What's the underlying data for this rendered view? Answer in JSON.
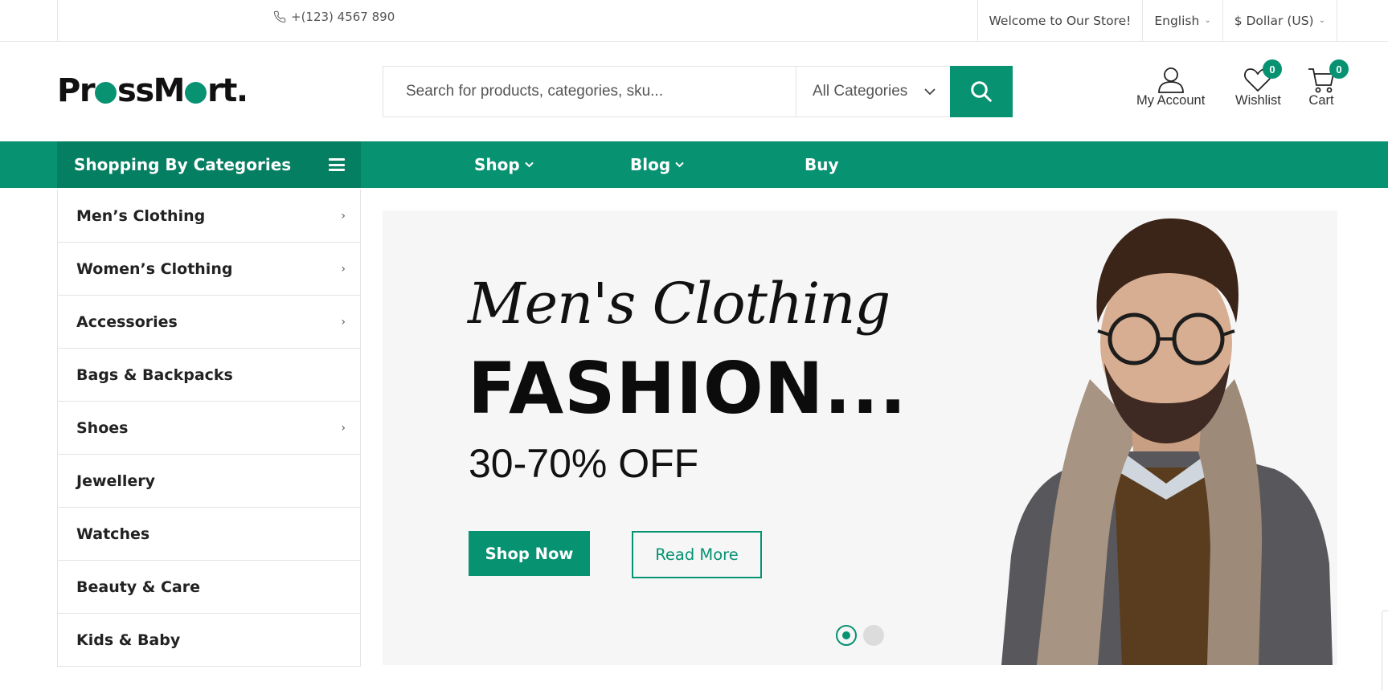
{
  "topbar": {
    "phone": "+(123) 4567 890",
    "welcome": "Welcome to Our Store!",
    "language": "English",
    "currency": "$ Dollar (US)"
  },
  "header": {
    "logo": {
      "part1": "Pr",
      "part2": "ssM",
      "part3": "rt."
    },
    "search": {
      "placeholder": "Search for products, categories, sku...",
      "category": "All Categories"
    },
    "account_label": "My Account",
    "wishlist_label": "Wishlist",
    "wishlist_count": "0",
    "cart_label": "Cart",
    "cart_count": "0"
  },
  "nav": {
    "categories_title": "Shopping By Categories",
    "items": [
      {
        "label": "Shop"
      },
      {
        "label": "Blog"
      },
      {
        "label": "Buy"
      }
    ]
  },
  "sidebar": {
    "items": [
      {
        "label": "Men’s Clothing",
        "has_submenu": true
      },
      {
        "label": "Women’s Clothing",
        "has_submenu": true
      },
      {
        "label": "Accessories",
        "has_submenu": true
      },
      {
        "label": "Bags & Backpacks",
        "has_submenu": false
      },
      {
        "label": "Shoes",
        "has_submenu": true
      },
      {
        "label": "Jewellery",
        "has_submenu": false
      },
      {
        "label": "Watches",
        "has_submenu": false
      },
      {
        "label": "Beauty & Care",
        "has_submenu": false
      },
      {
        "label": "Kids & Baby",
        "has_submenu": false
      }
    ]
  },
  "hero": {
    "script_title": "Men's Clothing",
    "title": "FASHION...",
    "subtitle": "30-70% OFF",
    "primary_button": "Shop Now",
    "secondary_button": "Read More",
    "slide_count": 2,
    "active_slide": 1
  },
  "colors": {
    "brand": "#079272",
    "brand_dark": "#057f62",
    "hero_bg": "#f6f6f6"
  }
}
